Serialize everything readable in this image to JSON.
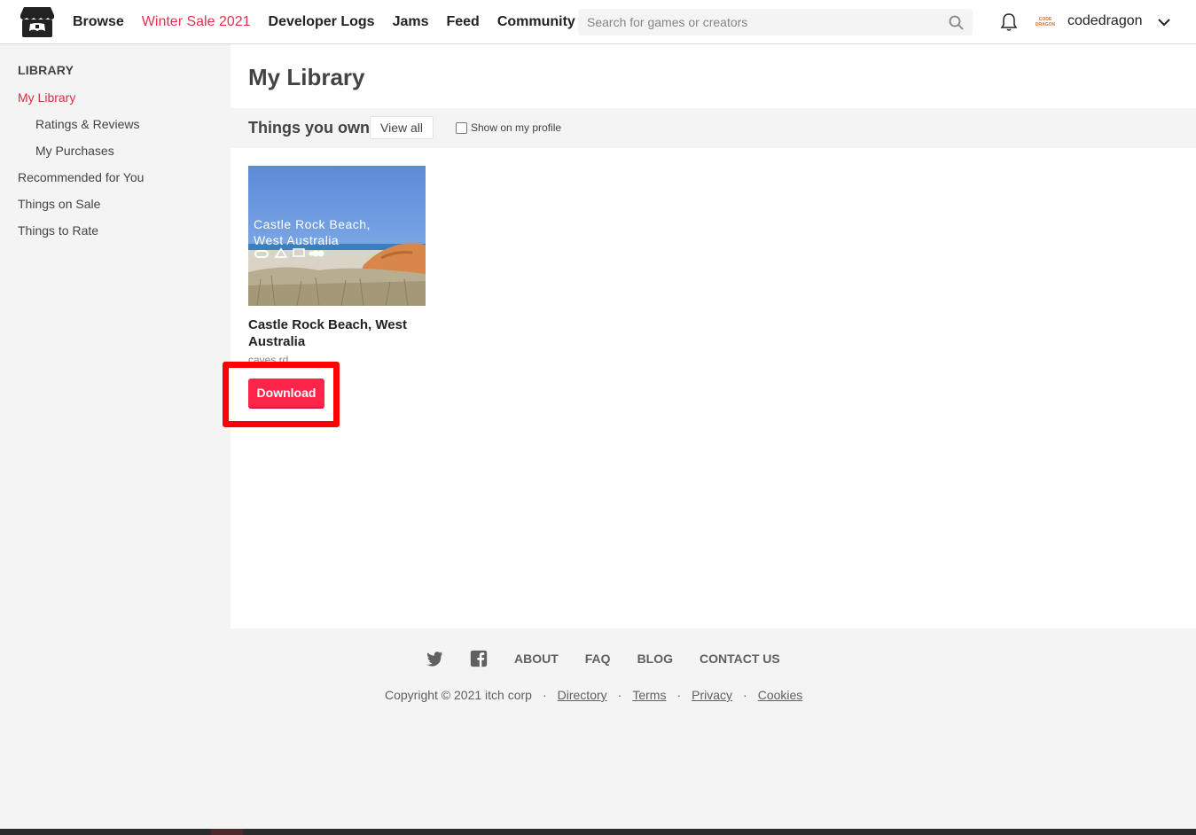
{
  "header": {
    "nav": [
      "Browse",
      "Winter Sale 2021",
      "Developer Logs",
      "Jams",
      "Feed",
      "Community"
    ],
    "search_placeholder": "Search for games or creators",
    "avatar_text_line1": "CODE",
    "avatar_text_line2": "DRAGON",
    "username": "codedragon"
  },
  "sidebar": {
    "heading": "LIBRARY",
    "items": [
      "My Library",
      "Ratings & Reviews",
      "My Purchases",
      "Recommended for You",
      "Things on Sale",
      "Things to Rate"
    ]
  },
  "main": {
    "title": "My Library",
    "section_title": "Things you own",
    "view_all": "View all",
    "show_on_profile": "Show on my profile",
    "game": {
      "thumb_text_line1": "Castle Rock Beach,",
      "thumb_text_line2": "West Australia",
      "title": "Castle Rock Beach, West Australia",
      "author": "caves rd",
      "download_label": "Download"
    }
  },
  "footer": {
    "links": [
      "ABOUT",
      "FAQ",
      "BLOG",
      "CONTACT US"
    ],
    "copyright": "Copyright © 2021 itch corp",
    "bottom_links": [
      "Directory",
      "Terms",
      "Privacy",
      "Cookies"
    ]
  },
  "colors": {
    "accent": "#da2c42",
    "download_button": "#ff2449",
    "highlight_box": "#ff0000"
  }
}
